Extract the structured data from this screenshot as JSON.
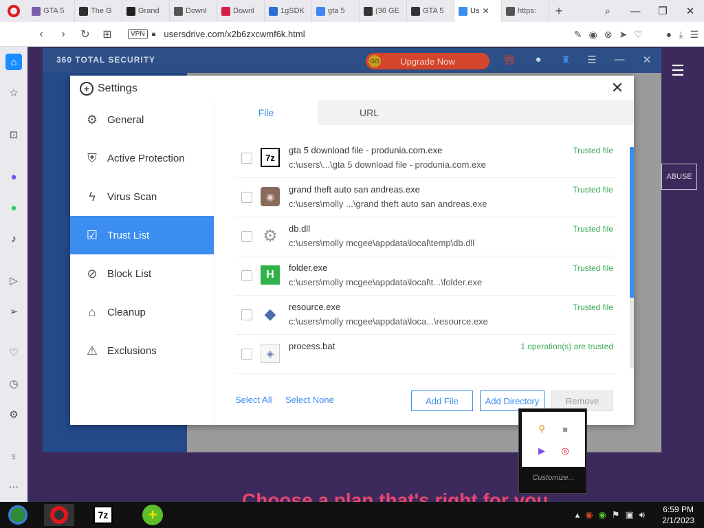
{
  "browser": {
    "tabs": [
      {
        "label": "GTA 5",
        "color": "#7b5ea7"
      },
      {
        "label": "The G",
        "color": "#2e2e2e"
      },
      {
        "label": "Grand",
        "color": "#222222"
      },
      {
        "label": "Downl",
        "color": "#555555"
      },
      {
        "label": "Downl",
        "color": "#d6204b"
      },
      {
        "label": "1gSDK",
        "color": "#2a6fd6"
      },
      {
        "label": "gta 5",
        "color": "#4285f4"
      },
      {
        "label": "(36 GE",
        "color": "#333333"
      },
      {
        "label": "GTA 5",
        "color": "#333333"
      },
      {
        "label": "Us",
        "color": "#3b8df0",
        "active": true
      },
      {
        "label": "https:",
        "color": "#555555"
      }
    ],
    "url": "usersdrive.com/x2b6zxcwmf6k.html",
    "vpn": "VPN"
  },
  "app360": {
    "title": "360 TOTAL SECURITY",
    "upgrade_label": "Upgrade Now",
    "go_badge": "GO"
  },
  "page": {
    "abuse_label": "ABUSE",
    "headline": "Choose a plan that's right for you"
  },
  "dialog": {
    "title": "Settings",
    "nav": [
      {
        "label": "General",
        "icon": "gear-icon",
        "glyph": "⚙"
      },
      {
        "label": "Active Protection",
        "icon": "shield-icon",
        "glyph": "⛨"
      },
      {
        "label": "Virus Scan",
        "icon": "bolt-icon",
        "glyph": "ϟ"
      },
      {
        "label": "Trust List",
        "icon": "trust-list-icon",
        "glyph": "☑",
        "active": true
      },
      {
        "label": "Block List",
        "icon": "block-list-icon",
        "glyph": "⊘"
      },
      {
        "label": "Cleanup",
        "icon": "broom-icon",
        "glyph": "⌂"
      },
      {
        "label": "Exclusions",
        "icon": "warning-icon",
        "glyph": "⚠"
      }
    ],
    "tabs": [
      {
        "label": "File",
        "active": true
      },
      {
        "label": "URL"
      }
    ],
    "files": [
      {
        "name": "gta 5 download file - produnia.com.exe",
        "path": "c:\\users\\...\\gta 5 download file - produnia.com.exe",
        "status": "Trusted file",
        "icon": "7zip-icon"
      },
      {
        "name": "grand theft auto san andreas.exe",
        "path": "c:\\users\\molly ...\\grand theft auto san andreas.exe",
        "status": "Trusted file",
        "icon": "game-icon"
      },
      {
        "name": "db.dll",
        "path": "c:\\users\\molly mcgee\\appdata\\local\\temp\\db.dll",
        "status": "Trusted file",
        "icon": "dll-gear-icon"
      },
      {
        "name": "folder.exe",
        "path": "c:\\users\\molly mcgee\\appdata\\local\\t...\\folder.exe",
        "status": "Trusted file",
        "icon": "folder-exe-icon"
      },
      {
        "name": "resource.exe",
        "path": "c:\\users\\molly mcgee\\appdata\\loca...\\resource.exe",
        "status": "Trusted file",
        "icon": "resource-exe-icon"
      },
      {
        "name": "process.bat",
        "path": "",
        "status": "1 operation(s) are trusted",
        "icon": "bat-file-icon"
      }
    ],
    "select_all": "Select All",
    "select_none": "Select None",
    "add_file": "Add File",
    "add_directory": "Add Directory",
    "remove": "Remove",
    "scroll_fraction": 0.68
  },
  "tray_popup": {
    "customize": "Customize..."
  },
  "taskbar": {
    "time": "6:59 PM",
    "date": "2/1/2023"
  }
}
